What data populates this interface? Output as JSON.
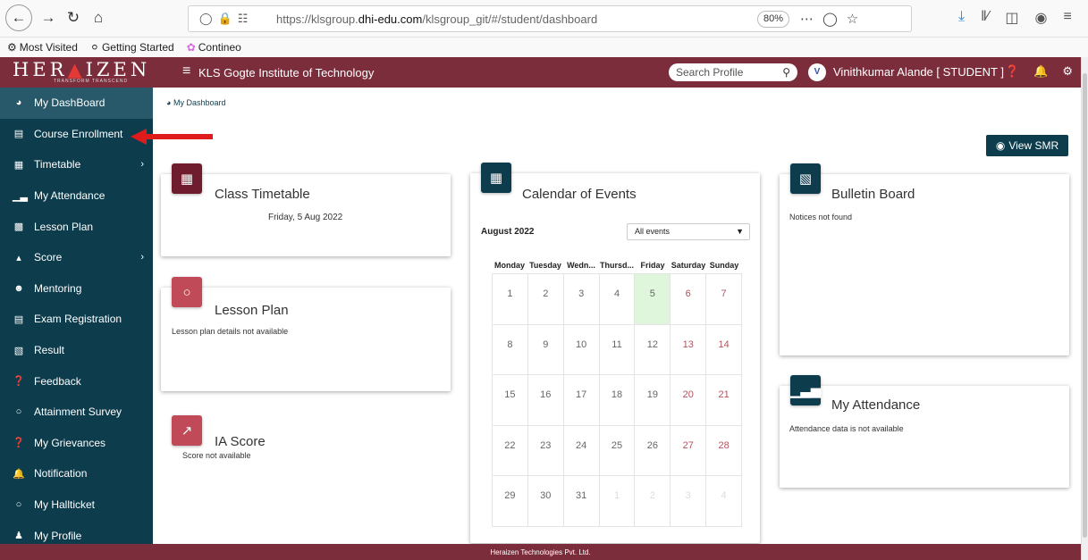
{
  "browser": {
    "url_prefix": "https://klsgroup.",
    "url_domain": "dhi-edu.com",
    "url_path": "/klsgroup_git/#/student/dashboard",
    "zoom": "80%",
    "bookmarks": [
      {
        "label": "Most Visited",
        "icon": "gear-icon"
      },
      {
        "label": "Getting Started",
        "icon": "firefox-icon"
      },
      {
        "label": "Contineo",
        "icon": "contineo-icon"
      }
    ]
  },
  "header": {
    "logo_text_a": "HER",
    "logo_text_b": "IZEN",
    "logo_tagline": "TRANSFORM TRANSCEND",
    "institute": "KLS Gogte Institute of Technology",
    "search_placeholder": "Search Profile",
    "avatar_letter": "V",
    "user": "Vinithkumar Alande [ STUDENT ]",
    "brand_color": "#7b2d3b"
  },
  "sidebar": {
    "bg_color": "#0d3c4d",
    "items": [
      {
        "label": "My DashBoard",
        "icon": "dashboard-icon"
      },
      {
        "label": "Course Enrollment",
        "icon": "id-card-icon"
      },
      {
        "label": "Timetable",
        "icon": "calendar-icon"
      },
      {
        "label": "My Attendance",
        "icon": "bar-chart-icon"
      },
      {
        "label": "Lesson Plan",
        "icon": "keyboard-icon"
      },
      {
        "label": "Score",
        "icon": "sitemap-icon"
      },
      {
        "label": "Mentoring",
        "icon": "user-circle-icon"
      },
      {
        "label": "Exam Registration",
        "icon": "list-icon"
      },
      {
        "label": "Result",
        "icon": "document-icon"
      },
      {
        "label": "Feedback",
        "icon": "question-circle-icon"
      },
      {
        "label": "Attainment Survey",
        "icon": "circle-icon"
      },
      {
        "label": "My Grievances",
        "icon": "question-circle-icon"
      },
      {
        "label": "Notification",
        "icon": "bell-icon"
      },
      {
        "label": "My Hallticket",
        "icon": "circle-icon"
      },
      {
        "label": "My Profile",
        "icon": "user-icon"
      }
    ]
  },
  "main": {
    "breadcrumb": "My Dashboard",
    "view_smr": "View SMR"
  },
  "cards": {
    "class_timetable": {
      "title": "Class Timetable",
      "sub": "Friday, 5 Aug 2022"
    },
    "lesson_plan": {
      "title": "Lesson Plan",
      "sub": "Lesson plan details not available"
    },
    "ia_score": {
      "title": "IA Score",
      "sub": "Score not available"
    },
    "calendar": {
      "title": "Calendar of Events",
      "month": "August 2022",
      "filter": "All events",
      "weekdays": [
        "Monday",
        "Tuesday",
        "Wedn...",
        "Thursd...",
        "Friday",
        "Saturday",
        "Sunday"
      ],
      "weeks": [
        [
          "1",
          "2",
          "3",
          "4",
          "5",
          "6",
          "7"
        ],
        [
          "8",
          "9",
          "10",
          "11",
          "12",
          "13",
          "14"
        ],
        [
          "15",
          "16",
          "17",
          "18",
          "19",
          "20",
          "21"
        ],
        [
          "22",
          "23",
          "24",
          "25",
          "26",
          "27",
          "28"
        ],
        [
          "29",
          "30",
          "31",
          "1",
          "2",
          "3",
          "4"
        ]
      ],
      "today": "5"
    },
    "bulletin": {
      "title": "Bulletin Board",
      "sub": "Notices not found"
    },
    "attendance": {
      "title": "My Attendance",
      "sub": "Attendance data is not available"
    }
  },
  "footer": {
    "text": "Heraizen Technologies Pvt. Ltd."
  }
}
